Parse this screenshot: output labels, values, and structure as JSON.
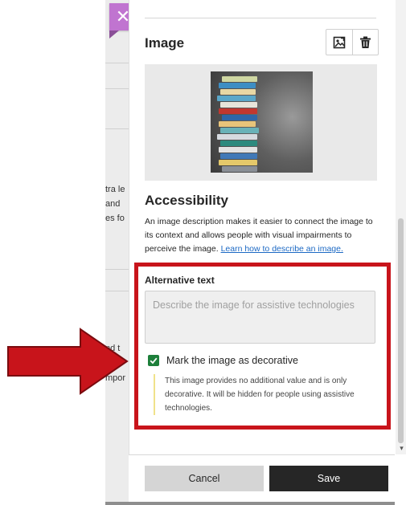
{
  "background": {
    "snippets": [
      "tra le",
      "and",
      "es fo",
      "nd t",
      "mpor"
    ]
  },
  "close_button": {
    "glyph": "✕"
  },
  "image_section": {
    "title": "Image",
    "icons": [
      "replace-image-icon",
      "trash-icon"
    ]
  },
  "accessibility": {
    "title": "Accessibility",
    "description": "An image description makes it easier to connect the image to its context and allows people with visual impairments to perceive the image.",
    "link": "Learn how to describe an image."
  },
  "alt_text": {
    "label": "Alternative text",
    "placeholder": "Describe the image for assistive technologies",
    "value": ""
  },
  "decorative": {
    "checked": true,
    "label": "Mark the image as decorative",
    "note": "This image provides no additional value and is only decorative. It will be hidden for people using assistive technologies."
  },
  "footer": {
    "cancel_label": "Cancel",
    "save_label": "Save"
  },
  "colors": {
    "accent_purple": "#c074d0",
    "checkbox_green": "#1d7f3a",
    "link_blue": "#1c69c4",
    "annotation_red": "#c8141b",
    "save_dark": "#262626"
  }
}
